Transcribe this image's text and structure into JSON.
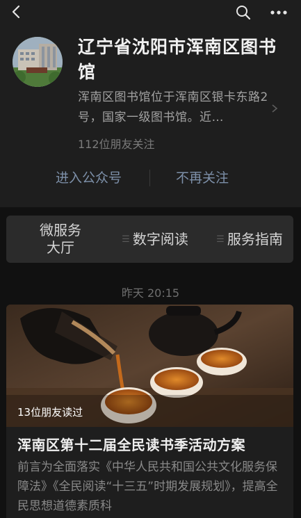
{
  "topbar": {
    "back_icon": "chevron-left-icon",
    "search_icon": "search-icon",
    "more_icon": "more-horizontal-icon"
  },
  "profile": {
    "avatar_icon": "library-building-avatar",
    "name": "辽宁省沈阳市浑南区图书馆",
    "description": "浑南区图书馆位于浑南区银卡东路2号，国家一级图书馆。近…",
    "followers": "112位朋友关注",
    "enter_label": "进入公众号",
    "unfollow_label": "不再关注"
  },
  "menu": {
    "items": [
      {
        "label": "微服务大厅"
      },
      {
        "label": "数字阅读"
      },
      {
        "label": "服务指南"
      }
    ]
  },
  "feed": {
    "timestamp": "昨天 20:15",
    "article": {
      "read_count": "13位朋友读过",
      "title": "浑南区第十二届全民读书季活动方案",
      "summary": "前言为全面落实《中华人民共和国公共文化服务保障法》《全民阅读“十三五”时期发展规划》，提高全民思想道德素质科"
    }
  },
  "colors": {
    "background": "#111111",
    "card": "#1e1e1e",
    "link": "#7d90a9",
    "menu_bg": "#2b2b2b"
  }
}
